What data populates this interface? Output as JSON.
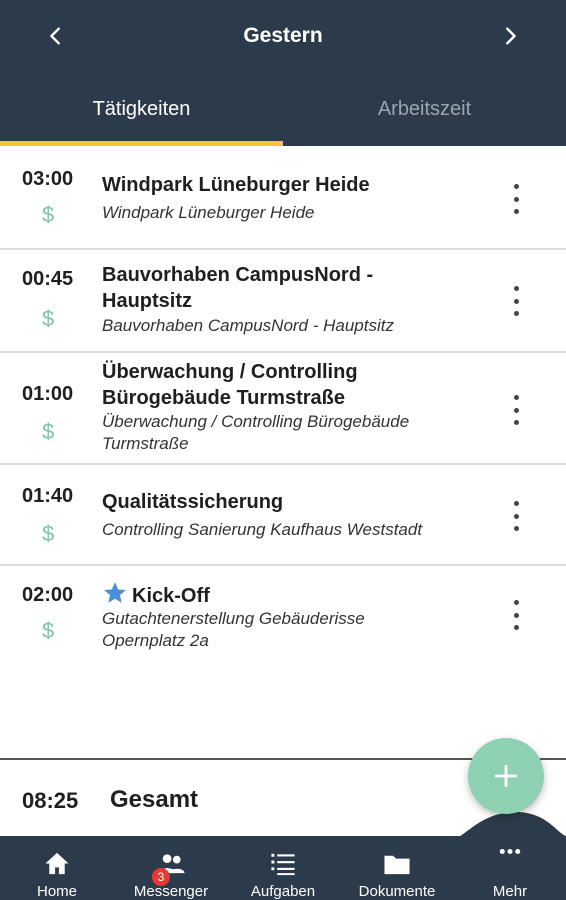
{
  "header": {
    "title": "Gestern",
    "prev_icon": "chevron-left-icon",
    "next_icon": "chevron-right-icon"
  },
  "tabs": [
    {
      "label": "Tätigkeiten",
      "active": true
    },
    {
      "label": "Arbeitszeit",
      "active": false
    }
  ],
  "entries": [
    {
      "time": "03:00",
      "billable": "$",
      "title": "Windpark Lüneburger Heide",
      "subtitle": "Windpark Lüneburger Heide"
    },
    {
      "time": "00:45",
      "billable": "$",
      "title": "Bauvorhaben CampusNord - Hauptsitz",
      "subtitle": "Bauvorhaben CampusNord - Hauptsitz"
    },
    {
      "time": "01:00",
      "billable": "$",
      "title": "Überwachung / Controlling Bürogebäude Turmstraße",
      "subtitle": "Überwachung / Controlling Bürogebäude Turmstraße"
    },
    {
      "time": "01:40",
      "billable": "$",
      "title": "Qualitätssicherung",
      "subtitle": "Controlling Sanierung Kaufhaus Weststadt"
    },
    {
      "time": "02:00",
      "billable": "$",
      "title": "Kick-Off",
      "subtitle": "Gutachtenerstellung Gebäuderisse Opernplatz 2a",
      "starred": true
    }
  ],
  "total": {
    "time": "08:25",
    "label": "Gesamt"
  },
  "fab": {
    "icon": "plus-icon"
  },
  "bottom_nav": [
    {
      "label": "Home",
      "icon": "home-icon"
    },
    {
      "label": "Messenger",
      "icon": "people-icon",
      "badge": "3"
    },
    {
      "label": "Aufgaben",
      "icon": "list-icon"
    },
    {
      "label": "Dokumente",
      "icon": "folder-icon"
    },
    {
      "label": "Mehr",
      "icon": "more-horizontal-icon"
    }
  ],
  "colors": {
    "header_bg": "#2c3b4b",
    "tab_indicator": "#f5c636",
    "billable": "#7cc6a6",
    "fab": "#8fd1b3",
    "star": "#4a90d9",
    "badge": "#e53935"
  }
}
